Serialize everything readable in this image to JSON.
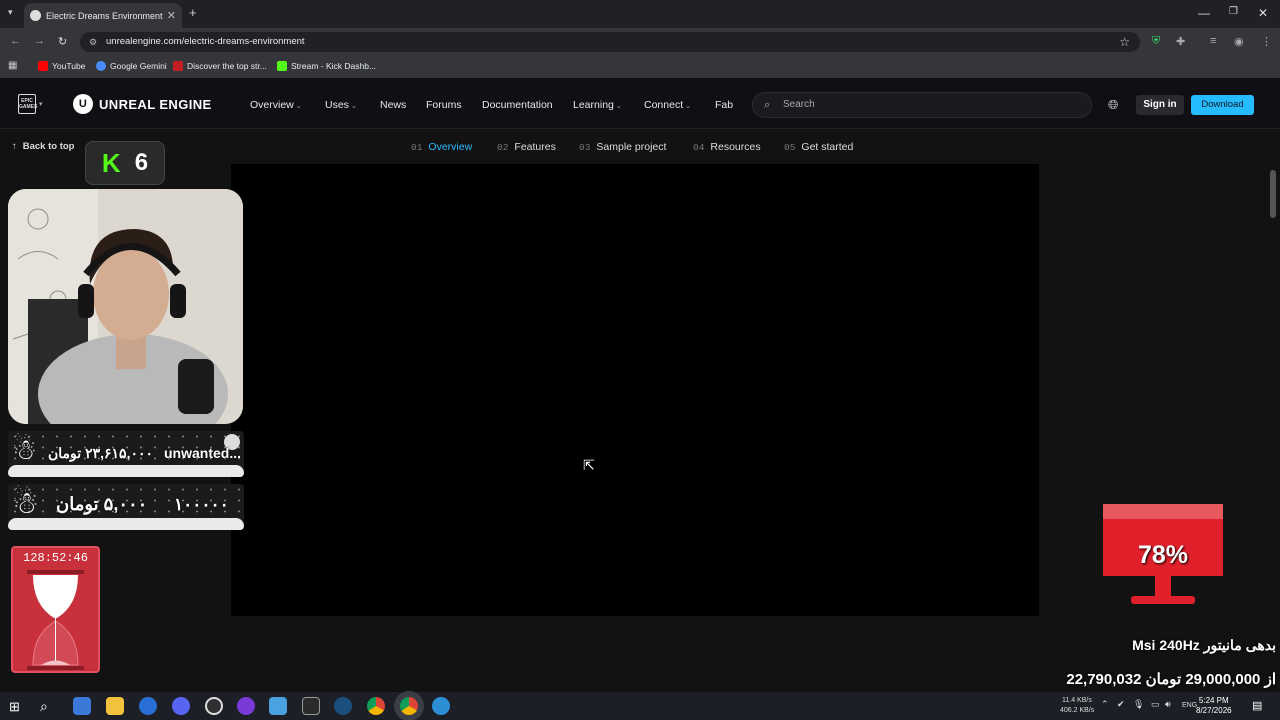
{
  "browser": {
    "tab_title": "Electric Dreams Environment | U",
    "url": "unrealengine.com/electric-dreams-environment",
    "bookmarks": [
      "YouTube",
      "Google Gemini",
      "Discover the top str...",
      "Stream - Kick Dashb..."
    ]
  },
  "site": {
    "logo_text": "UNREAL ENGINE",
    "epic_logo_text": "EPIC GAMES",
    "nav": [
      "Overview",
      "Uses",
      "News",
      "Forums",
      "Documentation",
      "Learning",
      "Connect",
      "Fab"
    ],
    "search_placeholder": "Search",
    "signin_label": "Sign in",
    "download_label": "Download"
  },
  "subnav": {
    "back_to_top": "Back to top",
    "items": [
      {
        "num": "01",
        "label": "Overview"
      },
      {
        "num": "02",
        "label": "Features"
      },
      {
        "num": "03",
        "label": "Sample project"
      },
      {
        "num": "04",
        "label": "Resources"
      },
      {
        "num": "05",
        "label": "Get started"
      }
    ]
  },
  "overlays": {
    "kick_logo": "K",
    "kick_count": "6",
    "goal1_amount": "۲۳,۶۱۵,۰۰۰ تومان",
    "goal1_name": "unwanted...",
    "goal2_text": "۵,۰۰۰ تومان",
    "goal2_num": "۱۰۰۰۰۰",
    "timer": "128:52:46",
    "monitor_percent": "78%",
    "monitor_title": "Msi 240Hz بدهی مانیتور",
    "monitor_amount": "22,790,032 از 29,000,000 تومان"
  },
  "taskbar": {
    "net_up": "11.4 KB/s",
    "net_down": "406.2 KB/s",
    "lang": "ENG",
    "time": "5:24 PM",
    "date": "8/27/2026"
  },
  "colors": {
    "accent": "#26bbff",
    "kick_green": "#53fc18",
    "overlay_red": "#c8303c"
  }
}
